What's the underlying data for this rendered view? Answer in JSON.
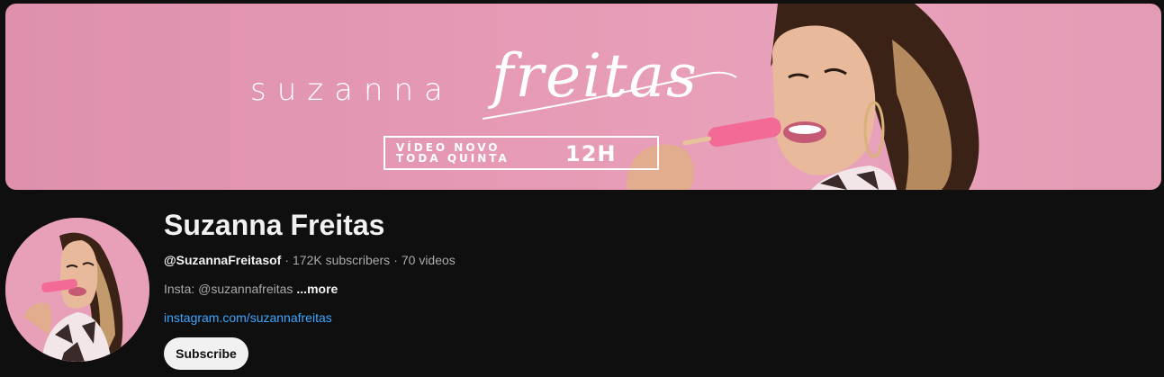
{
  "banner": {
    "name_light": "suzanna",
    "name_script": "freitas",
    "schedule_line1": "VÍDEO NOVO",
    "schedule_line2": "TODA QUINTA",
    "schedule_time": "12H",
    "background_color": "#e69ab5"
  },
  "channel": {
    "name": "Suzanna Freitas",
    "handle": "@SuzannaFreitasof",
    "subscribers": "172K subscribers",
    "videos": "70 videos",
    "separator": "·",
    "description": "Insta: @suzannafreitas",
    "more_label": "...more",
    "link": "instagram.com/suzannafreitas"
  },
  "actions": {
    "subscribe_label": "Subscribe"
  },
  "colors": {
    "page_background": "#0f0f0f",
    "link": "#3ea6ff",
    "secondary_text": "#aaaaaa",
    "primary_text": "#f1f1f1"
  }
}
